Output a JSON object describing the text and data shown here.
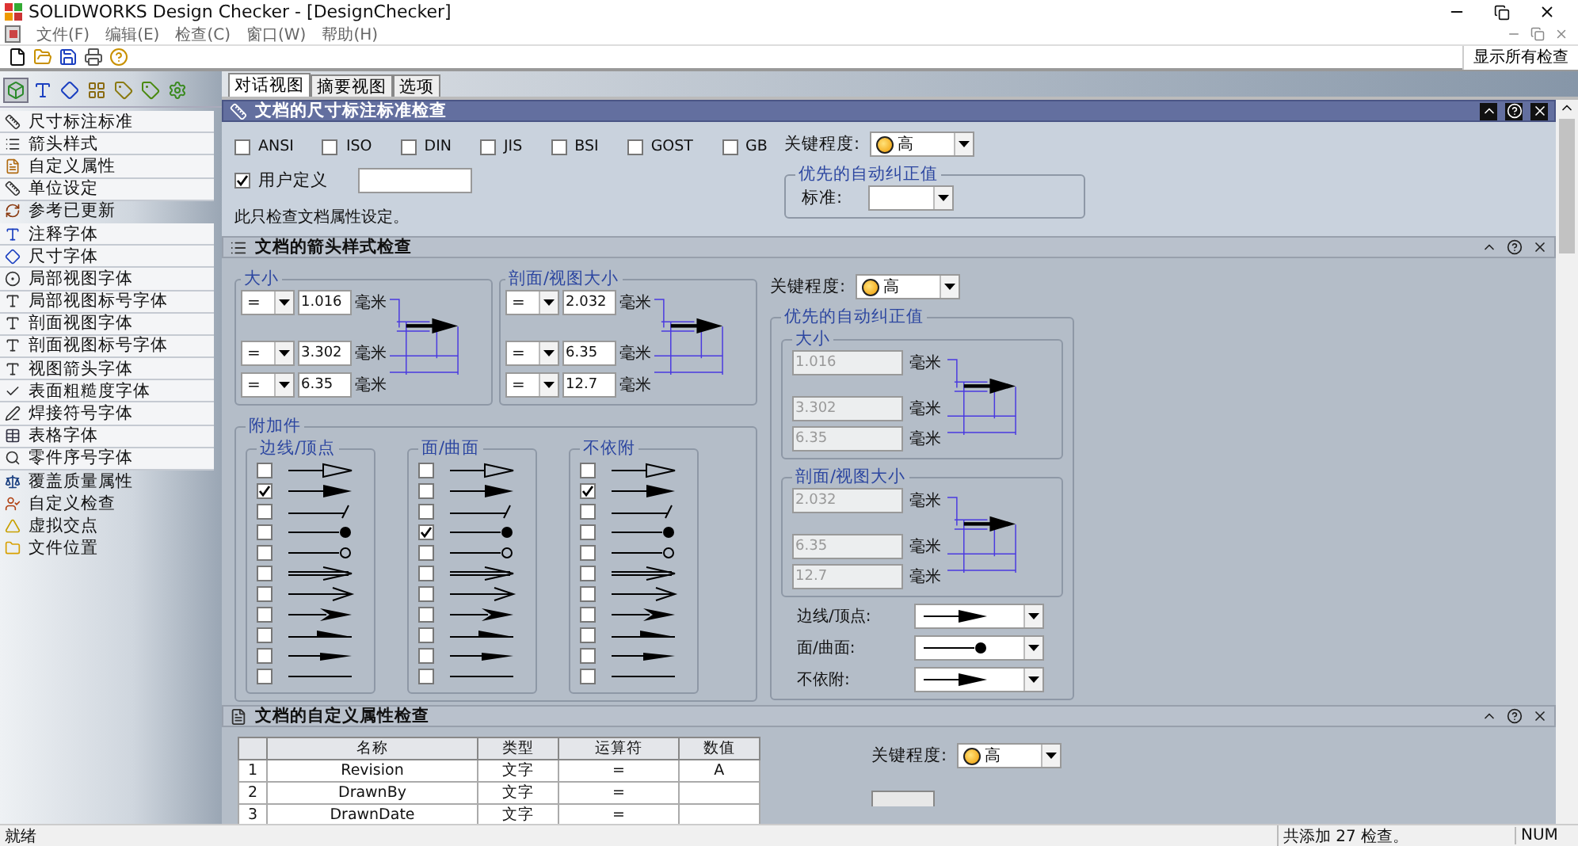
{
  "window": {
    "title": "SOLIDWORKS Design Checker - [DesignChecker]"
  },
  "menu": [
    "文件(F)",
    "编辑(E)",
    "检查(C)",
    "窗口(W)",
    "帮助(H)"
  ],
  "toolbar": {
    "show_all": "显示所有检查"
  },
  "sidebar": {
    "tabs": [
      {
        "selected": true
      },
      {
        "selected": false
      },
      {
        "selected": false
      },
      {
        "selected": false
      },
      {
        "selected": false
      },
      {
        "selected": false
      },
      {
        "selected": false
      }
    ],
    "items": [
      {
        "label": "尺寸标注标准",
        "framed": true
      },
      {
        "label": "箭头样式",
        "framed": true
      },
      {
        "label": "自定义属性",
        "framed": true
      },
      {
        "label": "单位设定",
        "framed": true
      },
      {
        "label": "参考已更新",
        "framed": false
      },
      {
        "label": "注释字体",
        "framed": true
      },
      {
        "label": "尺寸字体",
        "framed": true
      },
      {
        "label": "局部视图字体",
        "framed": true
      },
      {
        "label": "局部视图标号字体",
        "framed": true
      },
      {
        "label": "剖面视图字体",
        "framed": true
      },
      {
        "label": "剖面视图标号字体",
        "framed": true
      },
      {
        "label": "视图箭头字体",
        "framed": true
      },
      {
        "label": "表面粗糙度字体",
        "framed": true
      },
      {
        "label": "焊接符号字体",
        "framed": true
      },
      {
        "label": "表格字体",
        "framed": true
      },
      {
        "label": "零件序号字体",
        "framed": true
      },
      {
        "label": "覆盖质量属性",
        "framed": false
      },
      {
        "label": "自定义检查",
        "framed": false
      },
      {
        "label": "虚拟交点",
        "framed": false
      },
      {
        "label": "文件位置",
        "framed": false
      }
    ]
  },
  "view_tabs": [
    {
      "label": "对话视图",
      "selected": true
    },
    {
      "label": "摘要视图",
      "selected": false
    },
    {
      "label": "选项",
      "selected": false
    }
  ],
  "dimension_check": {
    "title": "文档的尺寸标注标准检查",
    "active": true,
    "standards": [
      {
        "label": "ANSI",
        "checked": false
      },
      {
        "label": "ISO",
        "checked": false
      },
      {
        "label": "DIN",
        "checked": false
      },
      {
        "label": "JIS",
        "checked": false
      },
      {
        "label": "BSI",
        "checked": false
      },
      {
        "label": "GOST",
        "checked": false
      },
      {
        "label": "GB",
        "checked": false
      }
    ],
    "custom": {
      "label": "用户定义",
      "checked": true
    },
    "note": "此只检查文档属性设定。",
    "severity": {
      "label": "关键程度:",
      "value": "高"
    },
    "autofix": {
      "title": "优先的自动纠正值",
      "label": "标准:"
    }
  },
  "arrow_check": {
    "title": "文档的箭头样式检查",
    "active": false,
    "size_groups": [
      {
        "title": "大小",
        "rows": [
          {
            "op": "=",
            "value": "1.016",
            "unit": "毫米"
          },
          {
            "op": "=",
            "value": "3.302",
            "unit": "毫米"
          },
          {
            "op": "=",
            "value": "6.35",
            "unit": "毫米"
          }
        ]
      },
      {
        "title": "剖面/视图大小",
        "rows": [
          {
            "op": "=",
            "value": "2.032",
            "unit": "毫米"
          },
          {
            "op": "=",
            "value": "6.35",
            "unit": "毫米"
          },
          {
            "op": "=",
            "value": "12.7",
            "unit": "毫米"
          }
        ]
      }
    ],
    "attach": {
      "title": "附加件",
      "groups": [
        {
          "title": "边线/顶点",
          "items": [
            {
              "kind": "open_triangle",
              "checked": false
            },
            {
              "kind": "filled_triangle",
              "checked": true
            },
            {
              "kind": "slash",
              "checked": false
            },
            {
              "kind": "dot",
              "checked": false
            },
            {
              "kind": "circle",
              "checked": false
            },
            {
              "kind": "open_arrow",
              "checked": false
            },
            {
              "kind": "chevron",
              "checked": false
            },
            {
              "kind": "notched",
              "checked": false
            },
            {
              "kind": "half",
              "checked": false
            },
            {
              "kind": "thin",
              "checked": false
            },
            {
              "kind": "none",
              "checked": false
            }
          ]
        },
        {
          "title": "面/曲面",
          "items": [
            {
              "kind": "open_triangle",
              "checked": false
            },
            {
              "kind": "filled_triangle",
              "checked": false
            },
            {
              "kind": "slash",
              "checked": false
            },
            {
              "kind": "dot",
              "checked": true
            },
            {
              "kind": "circle",
              "checked": false
            },
            {
              "kind": "open_arrow",
              "checked": false
            },
            {
              "kind": "chevron",
              "checked": false
            },
            {
              "kind": "notched",
              "checked": false
            },
            {
              "kind": "half",
              "checked": false
            },
            {
              "kind": "thin",
              "checked": false
            },
            {
              "kind": "none",
              "checked": false
            }
          ]
        },
        {
          "title": "不依附",
          "items": [
            {
              "kind": "open_triangle",
              "checked": false
            },
            {
              "kind": "filled_triangle",
              "checked": true
            },
            {
              "kind": "slash",
              "checked": false
            },
            {
              "kind": "dot",
              "checked": false
            },
            {
              "kind": "circle",
              "checked": false
            },
            {
              "kind": "open_arrow",
              "checked": false
            },
            {
              "kind": "chevron",
              "checked": false
            },
            {
              "kind": "notched",
              "checked": false
            },
            {
              "kind": "half",
              "checked": false
            },
            {
              "kind": "thin",
              "checked": false
            },
            {
              "kind": "none",
              "checked": false
            }
          ]
        }
      ]
    },
    "severity": {
      "label": "关键程度:",
      "value": "高"
    },
    "autofix": {
      "title": "优先的自动纠正值",
      "size_groups": [
        {
          "title": "大小",
          "rows": [
            {
              "value": "1.016",
              "unit": "毫米"
            },
            {
              "value": "3.302",
              "unit": "毫米"
            },
            {
              "value": "6.35",
              "unit": "毫米"
            }
          ]
        },
        {
          "title": "剖面/视图大小",
          "rows": [
            {
              "value": "2.032",
              "unit": "毫米"
            },
            {
              "value": "6.35",
              "unit": "毫米"
            },
            {
              "value": "12.7",
              "unit": "毫米"
            }
          ]
        }
      ],
      "styles": [
        {
          "label": "边线/顶点:",
          "kind": "filled_triangle"
        },
        {
          "label": "面/曲面:",
          "kind": "dot"
        },
        {
          "label": "不依附:",
          "kind": "filled_triangle"
        }
      ]
    }
  },
  "property_check": {
    "title": "文档的自定义属性检查",
    "active": false,
    "columns": [
      "名称",
      "类型",
      "运算符",
      "数值"
    ],
    "rows": [
      {
        "number": "1",
        "cells": [
          "Revision",
          "文字",
          "=",
          "A"
        ]
      },
      {
        "number": "2",
        "cells": [
          "DrawnBy",
          "文字",
          "="
        ]
      },
      {
        "number": "3",
        "cells": [
          "DrawnDate",
          "文字",
          "="
        ]
      }
    ],
    "severity": {
      "label": "关键程度:",
      "value": "高"
    }
  },
  "status_bar": {
    "text": "就绪",
    "count": "共添加 27 检查。",
    "num": "NUM"
  }
}
